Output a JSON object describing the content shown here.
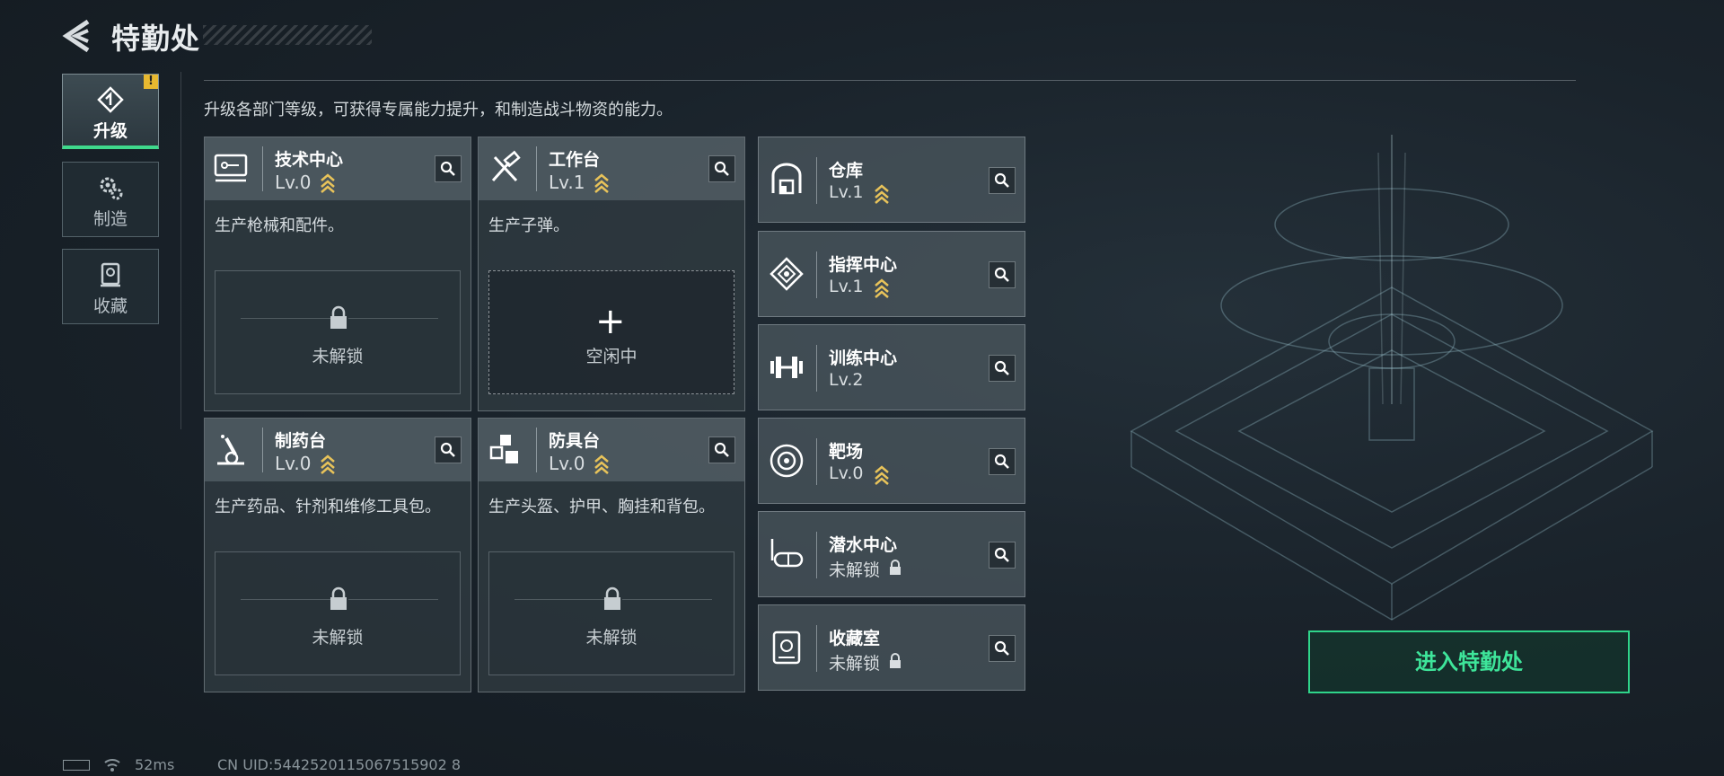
{
  "header": {
    "title": "特勤处"
  },
  "nav": [
    {
      "label": "升级",
      "icon": "upgrade-icon",
      "badge": "!"
    },
    {
      "label": "制造",
      "icon": "gears-icon"
    },
    {
      "label": "收藏",
      "icon": "trophy-icon"
    }
  ],
  "description": "升级各部门等级，可获得专属能力提升，和制造战斗物资的能力。",
  "large_cards": [
    {
      "name": "技术中心",
      "level": "Lv.0",
      "desc": "生产枪械和配件。",
      "slot": "未解锁",
      "icon": "computer-icon"
    },
    {
      "name": "工作台",
      "level": "Lv.1",
      "desc": "生产子弹。",
      "slot": "空闲中",
      "icon": "tools-icon"
    },
    {
      "name": "制药台",
      "level": "Lv.0",
      "desc": "生产药品、针剂和维修工具包。",
      "slot": "未解锁",
      "icon": "microscope-icon"
    },
    {
      "name": "防具台",
      "level": "Lv.0",
      "desc": "生产头盔、护甲、胸挂和背包。",
      "slot": "未解锁",
      "icon": "armor-cubes-icon"
    }
  ],
  "small_cards": [
    {
      "name": "仓库",
      "level": "Lv.1",
      "icon": "warehouse-icon"
    },
    {
      "name": "指挥中心",
      "level": "Lv.1",
      "icon": "command-chip-icon"
    },
    {
      "name": "训练中心",
      "level": "Lv.2",
      "icon": "dumbbell-icon"
    },
    {
      "name": "靶场",
      "level": "Lv.0",
      "icon": "target-icon"
    },
    {
      "name": "潜水中心",
      "level": "未解锁",
      "icon": "diving-mask-icon"
    },
    {
      "name": "收藏室",
      "level": "未解锁",
      "icon": "vault-icon"
    }
  ],
  "enter_button": "进入特勤处",
  "status": {
    "ping": "52ms",
    "uid": "CN UID:5442520115067515902 8"
  },
  "colors": {
    "accent": "#3ee59a",
    "upgrade_chevron": "#e8c35a",
    "badge": "#e8b930"
  }
}
